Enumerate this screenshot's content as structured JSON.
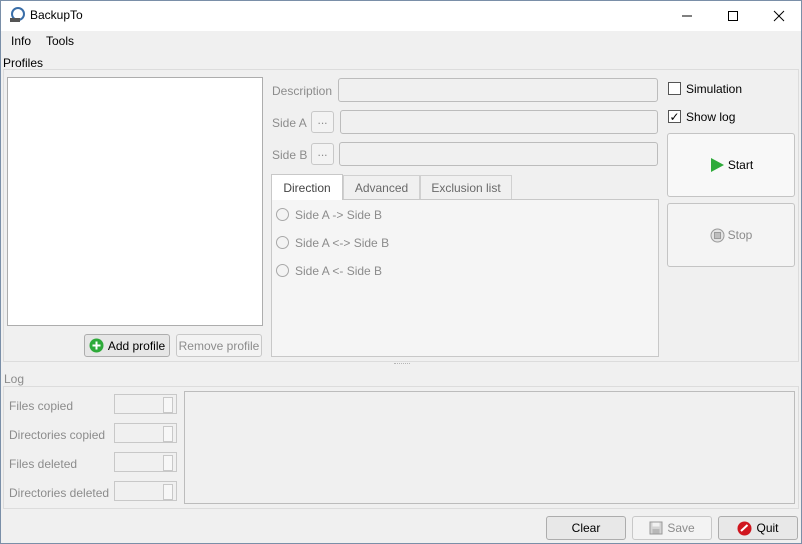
{
  "window": {
    "title": "BackupTo"
  },
  "menu": {
    "info": "Info",
    "tools": "Tools"
  },
  "profiles": {
    "section_label": "Profiles",
    "add_button": "Add profile",
    "remove_button": "Remove profile"
  },
  "form": {
    "description_label": "Description",
    "side_a_label": "Side A",
    "side_b_label": "Side B",
    "browse_label": "..."
  },
  "tabs": [
    "Direction",
    "Advanced",
    "Exclusion list"
  ],
  "direction_options": [
    "Side A -> Side B",
    "Side A <-> Side B",
    "Side A <- Side B"
  ],
  "options": {
    "simulation_label": "Simulation",
    "simulation_checked": false,
    "show_log_label": "Show log",
    "show_log_checked": true
  },
  "actions": {
    "start": "Start",
    "stop": "Stop"
  },
  "log": {
    "section_label": "Log",
    "files_copied": "Files copied",
    "dirs_copied": "Directories copied",
    "files_deleted": "Files deleted",
    "dirs_deleted": "Directories deleted"
  },
  "footer": {
    "clear": "Clear",
    "save": "Save",
    "quit": "Quit"
  },
  "colors": {
    "start_icon": "#2eaa3a",
    "add_icon": "#2eaa3a",
    "quit_icon": "#d0161f"
  }
}
